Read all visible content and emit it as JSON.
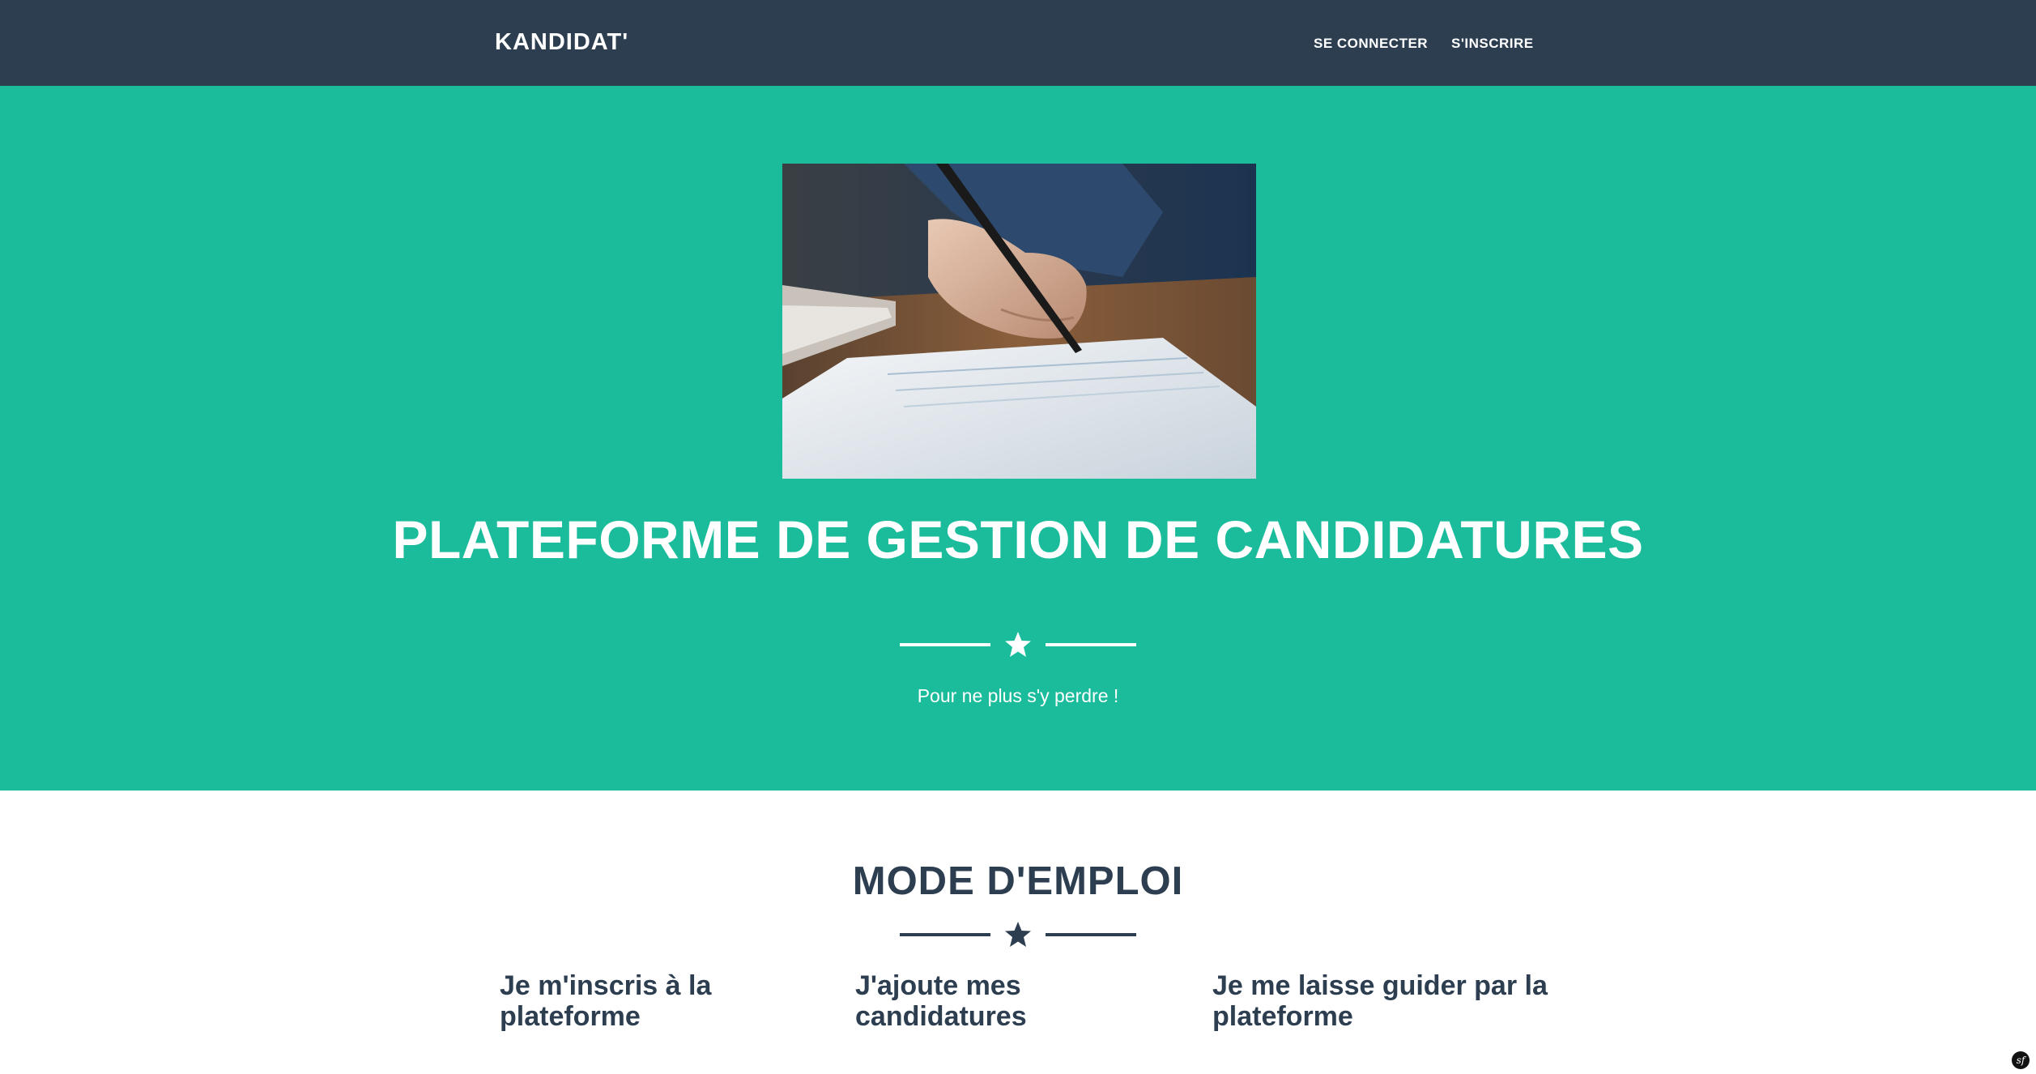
{
  "navbar": {
    "brand": "KANDIDAT'",
    "links": [
      {
        "label": "SE CONNECTER"
      },
      {
        "label": "S'INSCRIRE"
      }
    ]
  },
  "hero": {
    "image": {
      "subject": "hand-writing-on-document-photo"
    },
    "title": "PLATEFORME DE GESTION DE CANDIDATURES",
    "divider_icon": "star-icon",
    "subtitle": "Pour ne plus s'y perdre !"
  },
  "section": {
    "title": "MODE D'EMPLOI",
    "divider_icon": "star-icon",
    "steps": [
      {
        "text": "Je m'inscris à la plateforme"
      },
      {
        "text": "J'ajoute mes candidatures"
      },
      {
        "text": "Je me laisse guider par la plateforme"
      }
    ]
  },
  "colors": {
    "navbar_bg": "#2c3e50",
    "hero_bg": "#1abc9c",
    "text_dark": "#2c3e50",
    "text_light": "#ffffff"
  }
}
